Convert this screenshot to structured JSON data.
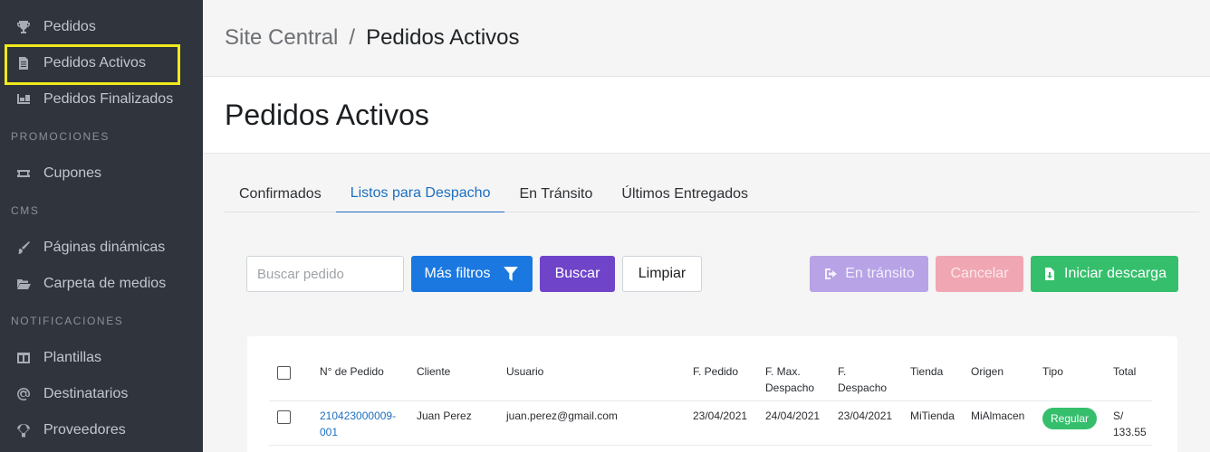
{
  "sidebar": {
    "items": [
      {
        "label": "Pedidos",
        "icon": "trophy-icon"
      },
      {
        "label": "Pedidos Activos",
        "icon": "document-icon"
      },
      {
        "label": "Pedidos Finalizados",
        "icon": "boxes-icon"
      },
      {
        "label": "Cupones",
        "icon": "ticket-icon"
      },
      {
        "label": "Páginas dinámicas",
        "icon": "paint-brush-icon"
      },
      {
        "label": "Carpeta de medios",
        "icon": "folder-open-icon"
      },
      {
        "label": "Plantillas",
        "icon": "columns-icon"
      },
      {
        "label": "Destinatarios",
        "icon": "at-icon"
      },
      {
        "label": "Proveedores",
        "icon": "parachute-box-icon"
      }
    ],
    "sections": [
      "PROMOCIONES",
      "CMS",
      "NOTIFICACIONES"
    ]
  },
  "breadcrumb": {
    "root": "Site Central",
    "separator": "/",
    "current": "Pedidos Activos"
  },
  "page": {
    "title": "Pedidos Activos"
  },
  "tabs": [
    {
      "label": "Confirmados",
      "active": false
    },
    {
      "label": "Listos para Despacho",
      "active": true
    },
    {
      "label": "En Tránsito",
      "active": false
    },
    {
      "label": "Últimos Entregados",
      "active": false
    }
  ],
  "filters": {
    "search_placeholder": "Buscar pedido",
    "more_filters_label": "Más filtros",
    "search_label": "Buscar",
    "clear_label": "Limpiar",
    "transit_label": "En tránsito",
    "cancel_label": "Cancelar",
    "download_label": "Iniciar descarga"
  },
  "table": {
    "headers": {
      "order_no": "N° de Pedido",
      "client": "Cliente",
      "user": "Usuario",
      "order_date_1": "F. Pedido",
      "max_dispatch_1": "F. Max.",
      "max_dispatch_2": "Despacho",
      "dispatch_date_1": "F.",
      "dispatch_date_2": "Despacho",
      "store": "Tienda",
      "origin": "Origen",
      "type": "Tipo",
      "total": "Total"
    },
    "rows": [
      {
        "order_no_1": "210423000009-",
        "order_no_2": "001",
        "client": "Juan Perez",
        "user": "juan.perez@gmail.com",
        "order_date": "23/04/2021",
        "max_dispatch": "24/04/2021",
        "dispatch_date": "23/04/2021",
        "store": "MiTienda",
        "origin": "MiAlmacen",
        "type": "Regular",
        "total_1": "S/",
        "total_2": "133.55"
      }
    ]
  },
  "colors": {
    "sidebar_bg": "#2f343d",
    "highlight": "#f1ea1c",
    "primary": "#1b78e0",
    "purple": "#7044c9",
    "success": "#35bf6c",
    "danger_disabled": "#f0a7b3",
    "purple_disabled": "#b7a3e6",
    "link": "#1d6fc0"
  }
}
